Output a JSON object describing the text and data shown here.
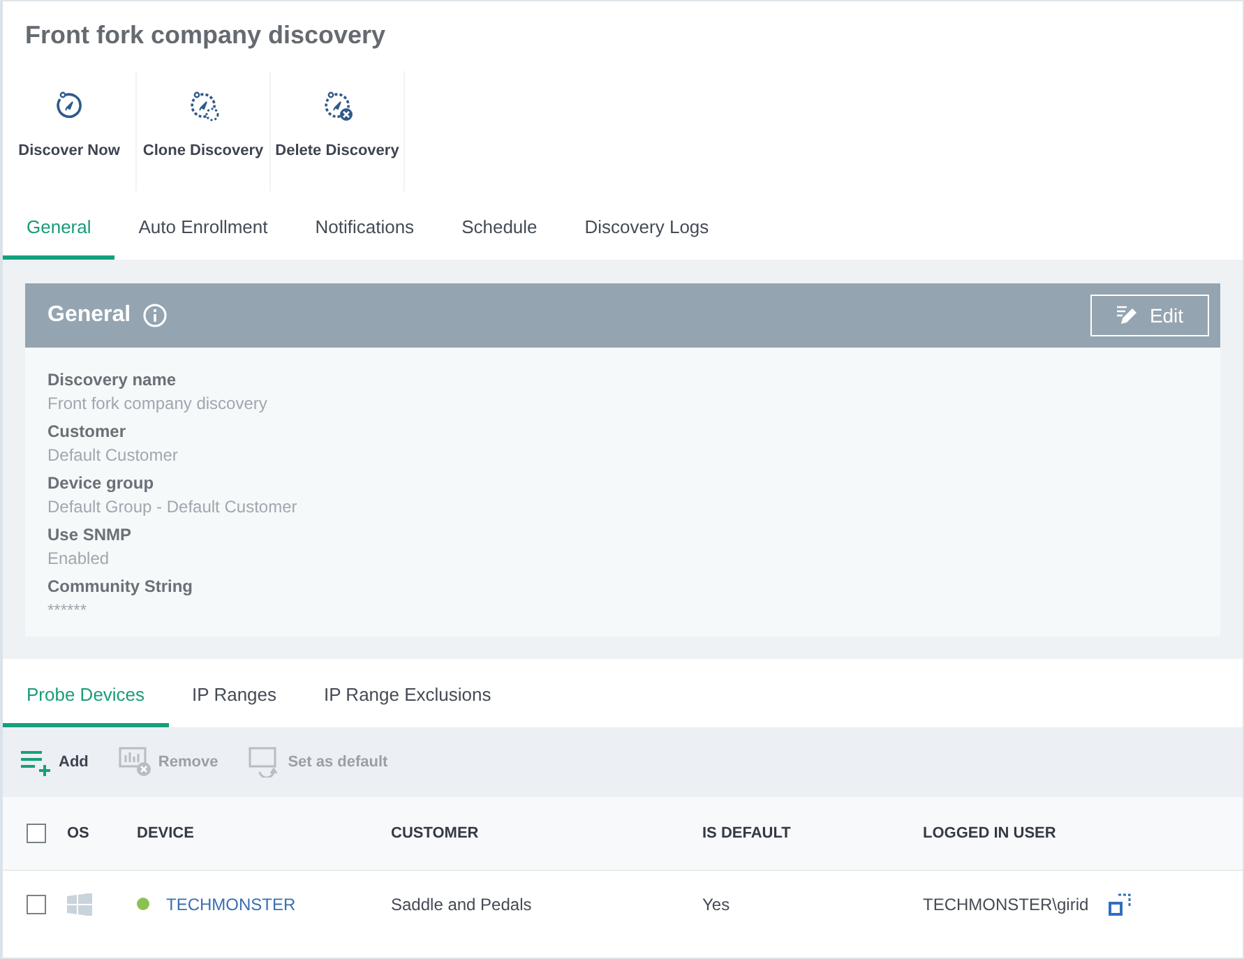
{
  "page": {
    "title": "Front fork company discovery"
  },
  "actions": [
    {
      "label": "Discover Now",
      "kind": "discover"
    },
    {
      "label": "Clone Discovery",
      "kind": "clone"
    },
    {
      "label": "Delete Discovery",
      "kind": "delete"
    }
  ],
  "tabs": [
    {
      "label": "General",
      "selected": true
    },
    {
      "label": "Auto Enrollment",
      "selected": false
    },
    {
      "label": "Notifications",
      "selected": false
    },
    {
      "label": "Schedule",
      "selected": false
    },
    {
      "label": "Discovery Logs",
      "selected": false
    }
  ],
  "general": {
    "title": "General",
    "edit_button": "Edit",
    "fields": [
      {
        "label": "Discovery name",
        "value": "Front fork company discovery"
      },
      {
        "label": "Customer",
        "value": "Default Customer"
      },
      {
        "label": "Device group",
        "value": "Default Group - Default Customer"
      },
      {
        "label": "Use SNMP",
        "value": "Enabled"
      },
      {
        "label": "Community String",
        "value": "******"
      }
    ]
  },
  "sub_tabs": [
    {
      "label": "Probe Devices",
      "selected": true
    },
    {
      "label": "IP Ranges",
      "selected": false
    },
    {
      "label": "IP Range Exclusions",
      "selected": false
    }
  ],
  "toolbar": [
    {
      "label": "Add",
      "kind": "add",
      "disabled": false
    },
    {
      "label": "Remove",
      "kind": "remove",
      "disabled": true
    },
    {
      "label": "Set as default",
      "kind": "default",
      "disabled": true
    }
  ],
  "table": {
    "columns": [
      "OS",
      "DEVICE",
      "CUSTOMER",
      "IS DEFAULT",
      "LOGGED IN USER"
    ],
    "header_checked": false,
    "rows": [
      {
        "checked": false,
        "os": {
          "kind": "windows"
        },
        "color": "#8cc152",
        "device": "TECHMONSTER",
        "customer": "Saddle and Pedals",
        "is_default": "Yes",
        "logged_in_user": "TECHMONSTER\\girid"
      }
    ]
  }
}
